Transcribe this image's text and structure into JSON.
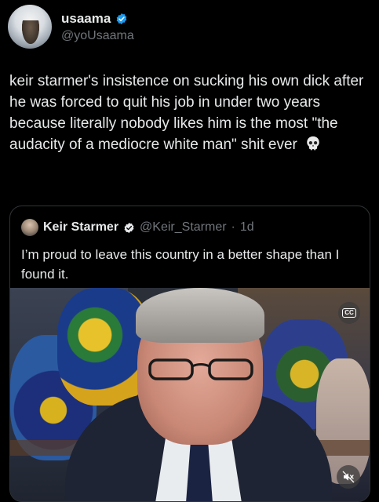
{
  "author": {
    "display_name": "usaama",
    "handle": "@yoUsaama",
    "verified": true
  },
  "tweet": {
    "text": "keir starmer's insistence on sucking his own dick after he was forced to quit his job in under two years because literally nobody likes him is the most \"the audacity of a mediocre white man\" shit ever",
    "emoji": "skull"
  },
  "quoted_tweet": {
    "display_name": "Keir Starmer",
    "handle": "@Keir_Starmer",
    "separator": "·",
    "time": "1d",
    "verified": true,
    "text": "I’m proud to leave this country in a better shape than I found it.",
    "media": {
      "cc_label": "CC",
      "mute_icon": "muted-speaker-icon"
    }
  },
  "colors": {
    "background": "#000000",
    "text": "#e7e9ea",
    "secondary_text": "#71767b",
    "verified_blue": "#1d9bf0",
    "border": "#2f3336"
  }
}
